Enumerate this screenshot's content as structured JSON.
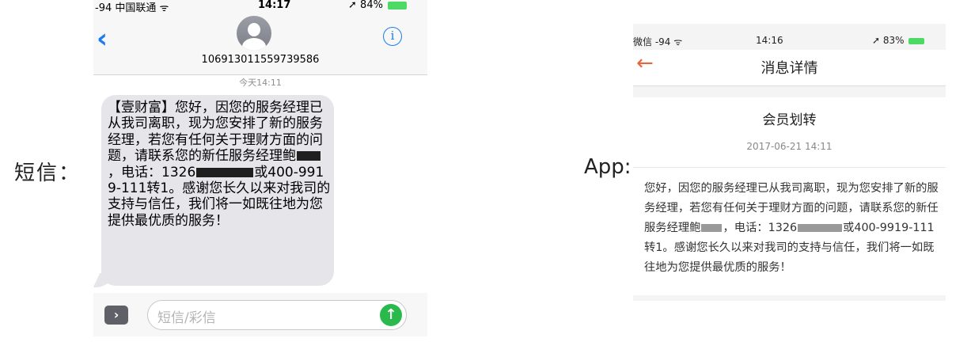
{
  "labels": {
    "sms": "短信：",
    "app": "App:"
  },
  "sms": {
    "status": {
      "carrier": "-94 中国联通",
      "time": "14:17",
      "battery": "84%"
    },
    "sender_number": "106913011559739586",
    "date": "今天14:11",
    "message": {
      "part1": "【壹财富】您好，因您的服务经理已从我司离职，现为您安排了新的服务经理，若您有任何关于理财方面的问题，请联系您的新任服务经理鲍",
      "part2": "，电话：1326",
      "part3": "或400-9919-111转1。感谢您长久以来对我司的支持与信任，我们将一如既往地为您提供最优质的服务！"
    },
    "input_placeholder": "短信/彩信",
    "icons": {
      "back": "chevron-left-icon",
      "info": "info-icon",
      "expand": "chevron-right-icon",
      "send": "arrow-up-icon"
    },
    "accent_color": "#1a7cf5"
  },
  "app": {
    "status": {
      "carrier": "微信 -94",
      "time": "14:16",
      "battery": "83%"
    },
    "nav_title": "消息详情",
    "card_title": "会员划转",
    "card_date": "2017-06-21 14:11",
    "body": {
      "part1": "您好，因您的服务经理已从我司离职，现为您安排了新的服务经理，若您有任何关于理财方面的问题，请联系您的新任服务经理鲍",
      "part2": "，电话：1326",
      "part3": "或400-9919-111转1。感谢您长久以来对我司的支持与信任，我们将一如既往地为您提供最优质的服务！"
    },
    "icons": {
      "back": "arrow-left-icon"
    },
    "accent_color": "#e8643c"
  }
}
